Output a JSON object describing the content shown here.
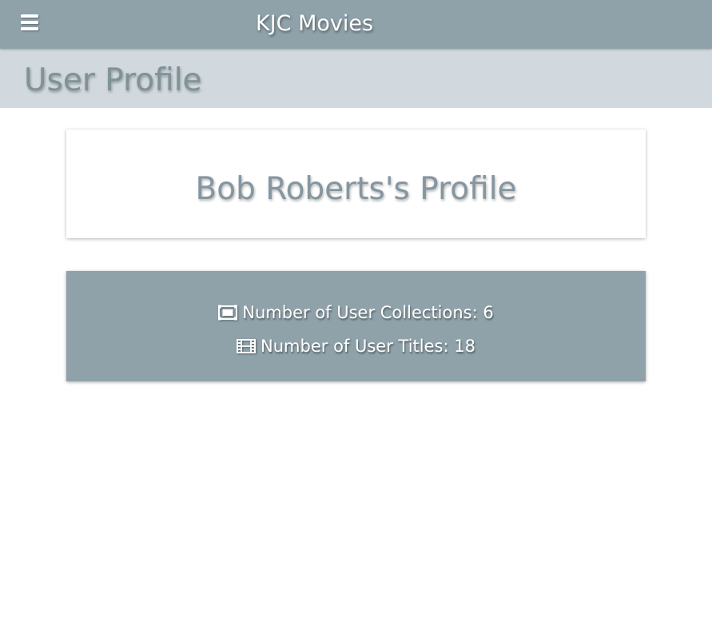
{
  "header": {
    "menu_icon": "hamburger-menu-icon",
    "app_title": "KJC Movies"
  },
  "subheader": {
    "page_title": "User Profile"
  },
  "profile": {
    "heading": "Bob Roberts's Profile"
  },
  "stats": {
    "collections_icon": "collection-frame-icon",
    "collections_label": "Number of User Collections: 6",
    "titles_icon": "film-icon",
    "titles_label": "Number of User Titles: 18"
  },
  "colors": {
    "topbar": "#8fa2aa",
    "subheader": "#d1d9de",
    "title_text": "#7f9298",
    "stats_card": "#8fa2aa",
    "background": "#ffffff"
  }
}
